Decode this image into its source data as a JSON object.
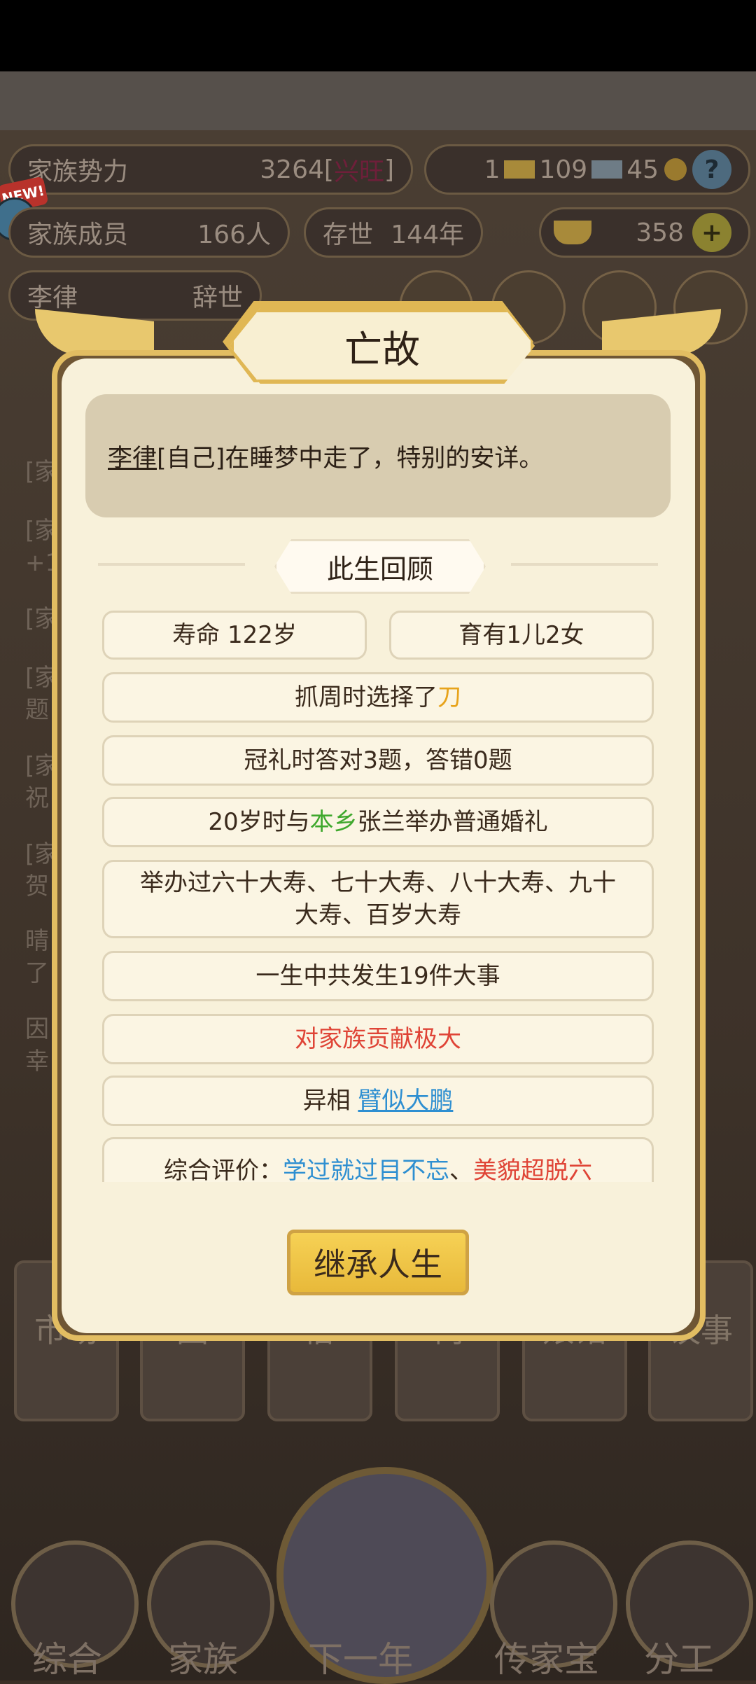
{
  "hud": {
    "clan_power_label": "家族势力",
    "clan_power_value": "3264[",
    "clan_power_rank": "兴旺",
    "clan_power_close": "]",
    "res1": "1",
    "res2": "109",
    "res3": "45",
    "help": "?",
    "members_label": "家族成员",
    "members_value": "166人",
    "alive_label": "存世",
    "alive_value": "144年",
    "gold_value": "358",
    "plus": "+",
    "person_name": "李律",
    "person_status": "辞世",
    "new_badge": "NEW!"
  },
  "background_text": {
    "fragments": [
      "[家",
      "[家",
      "+1",
      "[家",
      "[家",
      "题",
      "[家",
      "祝",
      "[家",
      "贺",
      "晴",
      "了",
      "因",
      "幸"
    ]
  },
  "bottom_tabs": [
    "市场",
    "园",
    "俗",
    "祠",
    "娘馆",
    "议事"
  ],
  "nav": {
    "items": [
      "综合",
      "家族",
      "下一年",
      "传家宝",
      "分工"
    ]
  },
  "modal": {
    "title": "亡故",
    "message_name": "李律",
    "message_rest": "[自己]在睡梦中走了，特别的安详。",
    "section_title": "此生回顾",
    "lifespan": "寿命 122岁",
    "children": "育有1儿2女",
    "zhuazhou_prefix": "抓周时选择了",
    "zhuazhou_item": "刀",
    "guanli": "冠礼时答对3题，答错0题",
    "marriage_prefix": "20岁时与",
    "marriage_place": "本乡",
    "marriage_rest": "张兰举办普通婚礼",
    "birthdays": "举办过六十大寿、七十大寿、八十大寿、九十大寿、百岁大寿",
    "events": "一生中共发生19件大事",
    "contribution": "对家族贡献极大",
    "yixiang_prefix": "异相",
    "yixiang_value": "臂似大鹏",
    "eval_prefix": "综合评价：",
    "eval_trait1": "学过就过目不忘",
    "eval_sep": "、",
    "eval_trait2": "美貌超脱六",
    "button": "继承人生"
  }
}
